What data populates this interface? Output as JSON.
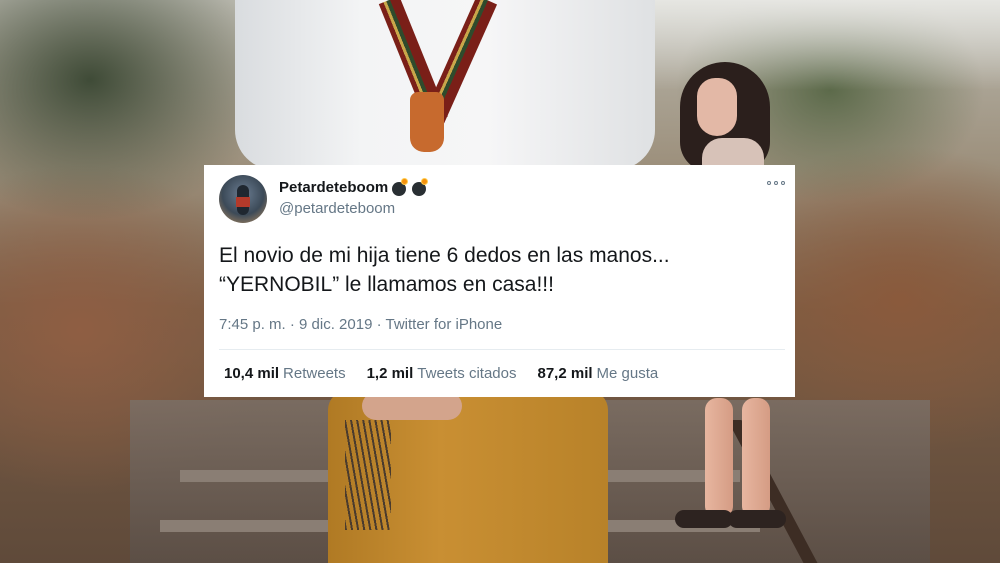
{
  "tweet": {
    "display_name": "Petardeteboom",
    "name_emojis": [
      "bomb-icon",
      "bomb-icon"
    ],
    "handle": "@petardeteboom",
    "text_line1": "El novio de mi hija tiene 6 dedos en las manos...",
    "text_line2": "“YERNOBIL” le llamamos en casa!!!",
    "timestamp": "7:45 p. m. · 9 dic. 2019",
    "separator": " · ",
    "source": "Twitter for iPhone",
    "stats": [
      {
        "count": "10,4 mil",
        "label": "Retweets"
      },
      {
        "count": "1,2 mil",
        "label": "Tweets citados"
      },
      {
        "count": "87,2 mil",
        "label": "Me gusta"
      }
    ]
  },
  "colors": {
    "text_primary": "#14171a",
    "text_secondary": "#657786",
    "card_bg": "#ffffff",
    "divider": "#e6ecf0"
  }
}
